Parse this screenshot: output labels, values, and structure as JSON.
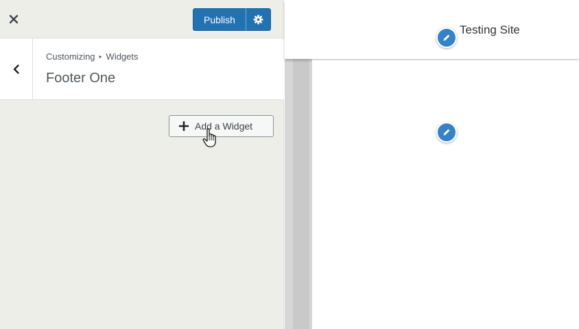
{
  "topbar": {
    "close_icon": "close-icon",
    "publish_label": "Publish",
    "settings_icon": "gear-icon"
  },
  "section": {
    "breadcrumb": [
      "Customizing",
      "Widgets"
    ],
    "title": "Footer One",
    "back_icon": "chevron-left-icon"
  },
  "widgets": {
    "add_label": "Add a Widget",
    "add_icon": "plus-icon"
  },
  "preview": {
    "site_title": "Testing Site",
    "edit_shortcut_icon": "pencil-icon"
  },
  "colors": {
    "accent": "#2271b1",
    "sidebar_bg": "#eeeee8",
    "shortcut": "#3582c4"
  }
}
